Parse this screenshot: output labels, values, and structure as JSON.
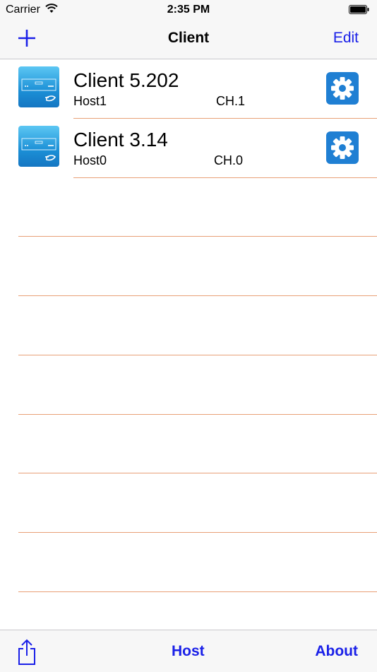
{
  "status_bar": {
    "carrier": "Carrier",
    "time": "2:35 PM"
  },
  "nav": {
    "title": "Client",
    "edit_label": "Edit",
    "add_icon": "plus-icon"
  },
  "clients": [
    {
      "name": "Client 5.202",
      "host": "Host1",
      "channel": "CH.1"
    },
    {
      "name": "Client 3.14",
      "host": "Host0",
      "channel": "CH.0"
    }
  ],
  "tab_bar": {
    "share_icon": "share-icon",
    "host_label": "Host",
    "about_label": "About"
  },
  "colors": {
    "accent": "#1a20e8",
    "separator": "#e8a077",
    "gear_bg": "#1f7fd3"
  }
}
